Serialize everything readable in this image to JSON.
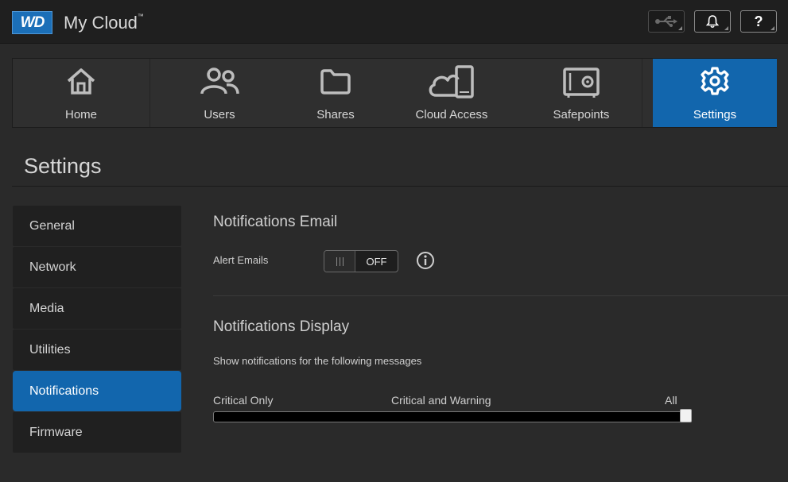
{
  "header": {
    "logo_text": "WD",
    "app_title": "My Cloud",
    "trademark": "™",
    "usb_icon": "usb-icon",
    "bell_icon": "bell-icon",
    "help_label": "?"
  },
  "nav": {
    "items": [
      {
        "label": "Home",
        "icon": "home-icon"
      },
      {
        "label": "Users",
        "icon": "users-icon"
      },
      {
        "label": "Shares",
        "icon": "folder-icon"
      },
      {
        "label": "Cloud Access",
        "icon": "cloud-device-icon"
      },
      {
        "label": "Safepoints",
        "icon": "safe-icon"
      },
      {
        "label": "Settings",
        "icon": "gear-icon",
        "active": true
      }
    ],
    "active_color": "#1266ad"
  },
  "page": {
    "title": "Settings"
  },
  "sidebar": {
    "items": [
      {
        "label": "General"
      },
      {
        "label": "Network"
      },
      {
        "label": "Media"
      },
      {
        "label": "Utilities"
      },
      {
        "label": "Notifications",
        "active": true
      },
      {
        "label": "Firmware"
      }
    ]
  },
  "email_section": {
    "title": "Notifications Email",
    "alert_label": "Alert Emails",
    "toggle_state": "OFF",
    "info_icon": "info-icon"
  },
  "display_section": {
    "title": "Notifications Display",
    "description": "Show notifications for the following messages",
    "levels": [
      "Critical Only",
      "Critical and Warning",
      "All"
    ],
    "selected": "All"
  }
}
